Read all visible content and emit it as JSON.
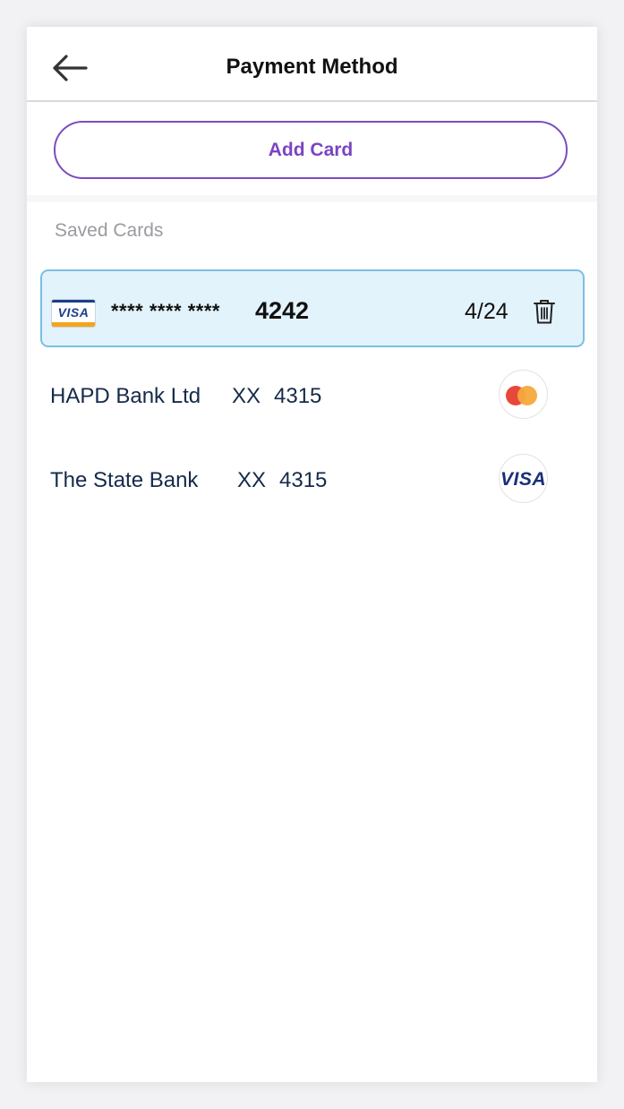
{
  "header": {
    "title": "Payment Method",
    "back_icon": "arrow-left-icon"
  },
  "actions": {
    "add_card_label": "Add Card"
  },
  "saved_cards": {
    "section_label": "Saved Cards",
    "selected": {
      "brand_label": "VISA",
      "masked_number": "**** **** ****",
      "last4": "4242",
      "expiry": "4/24",
      "delete_icon": "trash-icon"
    },
    "banks": [
      {
        "name": "HAPD Bank Ltd",
        "mask": "XX",
        "number": "4315",
        "logo": "mastercard-icon"
      },
      {
        "name": "The State Bank",
        "mask": "XX",
        "number": "4315",
        "logo": "visa-icon",
        "logo_text": "VISA"
      }
    ]
  },
  "colors": {
    "accent_purple": "#7a44c4",
    "selected_bg": "#e3f3fb",
    "selected_border": "#7bbfe6",
    "bank_text": "#152a4a"
  }
}
